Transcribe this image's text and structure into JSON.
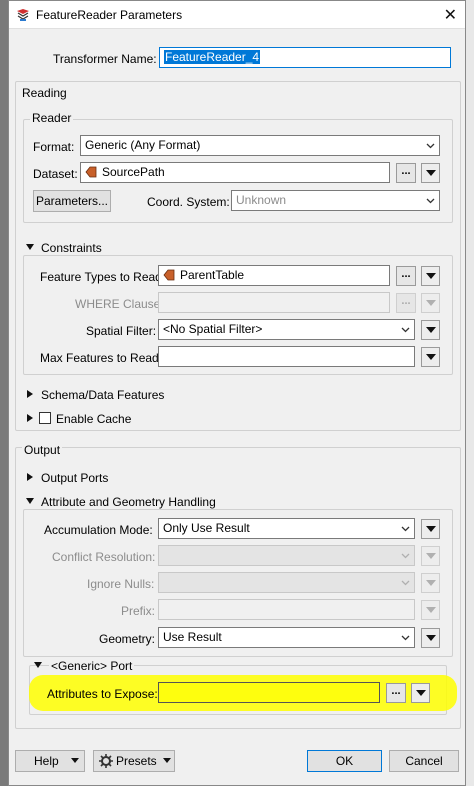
{
  "window": {
    "title": "FeatureReader Parameters"
  },
  "transformer": {
    "label": "Transformer Name:",
    "value": "FeatureReader_4"
  },
  "reading": {
    "title": "Reading",
    "reader": {
      "title": "Reader",
      "format_label": "Format:",
      "format_value": "Generic (Any Format)",
      "dataset_label": "Dataset:",
      "dataset_value": "SourcePath",
      "parameters_button": "Parameters...",
      "coord_label": "Coord. System:",
      "coord_value": "Unknown"
    },
    "constraints": {
      "title": "Constraints",
      "feature_types_label": "Feature Types to Read:",
      "feature_types_value": "ParentTable",
      "where_label": "WHERE Clause:",
      "where_value": "",
      "spatial_label": "Spatial Filter:",
      "spatial_value": "<No Spatial Filter>",
      "max_label": "Max Features to Read:",
      "max_value": ""
    },
    "schema_label": "Schema/Data Features",
    "cache_label": "Enable Cache",
    "cache_checked": false
  },
  "output": {
    "title": "Output",
    "ports_label": "Output Ports",
    "attr_geom": {
      "title": "Attribute and Geometry Handling",
      "accum_label": "Accumulation Mode:",
      "accum_value": "Only Use Result",
      "conflict_label": "Conflict Resolution:",
      "conflict_value": "",
      "nulls_label": "Ignore Nulls:",
      "nulls_value": "",
      "prefix_label": "Prefix:",
      "prefix_value": "",
      "geometry_label": "Geometry:",
      "geometry_value": "Use Result"
    },
    "generic_port": {
      "title": "<Generic> Port",
      "attrs_label": "Attributes to Expose:",
      "attrs_value": ""
    }
  },
  "buttons": {
    "dots": "...",
    "help": "Help",
    "presets": "Presets",
    "ok": "OK",
    "cancel": "Cancel"
  },
  "icons": [
    "app-icon",
    "close-icon",
    "reader-icon",
    "chevron-down-icon",
    "gear-icon",
    "triangle-down-icon",
    "triangle-right-icon"
  ],
  "colors": {
    "highlight": "#ffff00",
    "selection": "#0078d7",
    "reader_tag": "#c8602a"
  }
}
